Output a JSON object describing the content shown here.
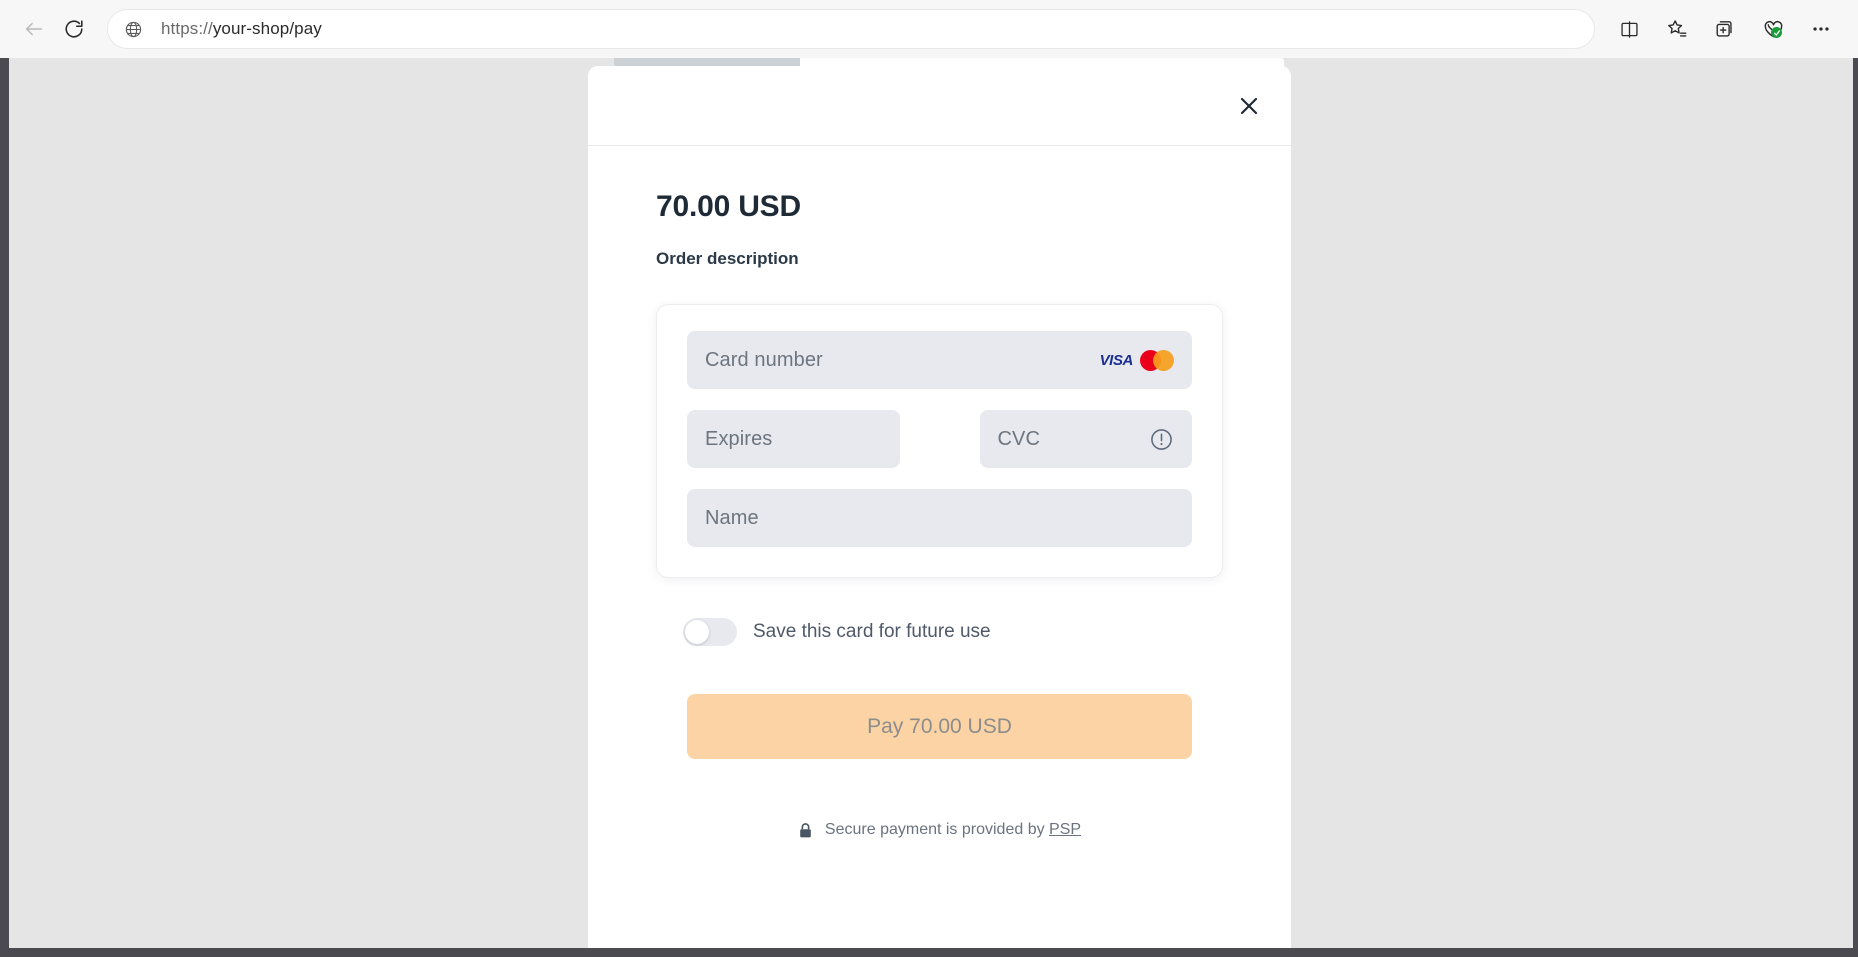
{
  "browser": {
    "back_label": "Back",
    "refresh_label": "Refresh",
    "url_scheme": "https://",
    "url_rest": "your-shop/pay",
    "url_full": "https://your-shop/pay",
    "actions": [
      {
        "name": "split-screen-icon",
        "label": "Split screen"
      },
      {
        "name": "favorites-icon",
        "label": "Favorites"
      },
      {
        "name": "collections-icon",
        "label": "Collections"
      },
      {
        "name": "browser-essentials-icon",
        "label": "Browser essentials"
      },
      {
        "name": "settings-more-icon",
        "label": "Settings and more"
      }
    ]
  },
  "modal": {
    "close_label": "✕",
    "amount": "70.00 USD",
    "order_description": "Order description",
    "form": {
      "card_number_placeholder": "Card number",
      "expires_placeholder": "Expires",
      "cvc_placeholder": "CVC",
      "name_placeholder": "Name",
      "card_number_value": "",
      "expires_value": "",
      "cvc_value": "",
      "name_value": "",
      "brands": [
        "VISA",
        "Mastercard"
      ],
      "visa_text": "VISA",
      "cvc_help_icon": "info-circle-icon"
    },
    "save_card": {
      "label": "Save this card for future use",
      "checked": false
    },
    "pay_button": {
      "label": "Pay 70.00 USD",
      "disabled": true
    },
    "footer": {
      "lock_icon": "lock-icon",
      "text_before": "Secure payment is provided by",
      "provider": "PSP"
    }
  },
  "colors": {
    "page_background": "#e5e5e5",
    "modal_background": "#ffffff",
    "field_background": "#e7e9ee",
    "pay_button": "#fbd3a4",
    "pay_button_text": "#8d8d8d",
    "amount_text": "#1f2a37",
    "placeholder_text": "#6d7580",
    "visa_blue": "#1a2f91",
    "mastercard_red": "#eb001b",
    "mastercard_orange": "#f79e1b",
    "secure_badge_green": "#1a9c3b"
  }
}
